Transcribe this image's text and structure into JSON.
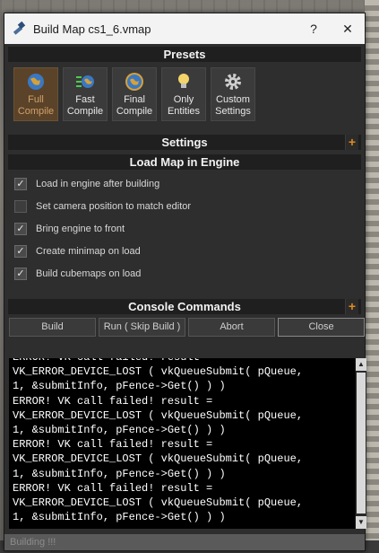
{
  "window": {
    "title": "Build Map cs1_6.vmap",
    "help_label": "?",
    "close_label": "✕"
  },
  "presets": {
    "header": "Presets",
    "items": [
      {
        "line1": "Full",
        "line2": "Compile",
        "icon": "globe-icon",
        "active": true
      },
      {
        "line1": "Fast",
        "line2": "Compile",
        "icon": "fast-globe-icon",
        "active": false
      },
      {
        "line1": "Final",
        "line2": "Compile",
        "icon": "globe-icon",
        "active": false
      },
      {
        "line1": "Only",
        "line2": "Entities",
        "icon": "lightbulb-icon",
        "active": false
      },
      {
        "line1": "Custom",
        "line2": "Settings",
        "icon": "gear-icon",
        "active": false
      }
    ]
  },
  "settings": {
    "header": "Settings",
    "expand_label": "+"
  },
  "load_map": {
    "header": "Load Map in Engine",
    "options": [
      {
        "label": "Load in engine after building",
        "checked": true
      },
      {
        "label": "Set camera position to match editor",
        "checked": false
      },
      {
        "label": "Bring engine to front",
        "checked": true
      },
      {
        "label": "Create minimap on load",
        "checked": true
      },
      {
        "label": "Build cubemaps on load",
        "checked": true
      }
    ]
  },
  "console_commands": {
    "header": "Console Commands",
    "expand_label": "+"
  },
  "buttons": {
    "build": "Build",
    "run": "Run ( Skip Build )",
    "abort": "Abort",
    "close": "Close"
  },
  "console": {
    "lines": [
      "ERROR! VK call failed! result =",
      "VK_ERROR_DEVICE_LOST ( vkQueueSubmit( pQueue,",
      "1, &submitInfo, pFence->Get() ) )",
      "ERROR! VK call failed! result =",
      "VK_ERROR_DEVICE_LOST ( vkQueueSubmit( pQueue,",
      "1, &submitInfo, pFence->Get() ) )",
      "ERROR! VK call failed! result =",
      "VK_ERROR_DEVICE_LOST ( vkQueueSubmit( pQueue,",
      "1, &submitInfo, pFence->Get() ) )",
      "ERROR! VK call failed! result =",
      "VK_ERROR_DEVICE_LOST ( vkQueueSubmit( pQueue,",
      "1, &submitInfo, pFence->Get() ) )"
    ]
  },
  "status": {
    "text": "Building !!!"
  },
  "colors": {
    "accent_orange": "#e28a1e",
    "active_preset": "#5b4329",
    "console_bg": "#000000"
  }
}
